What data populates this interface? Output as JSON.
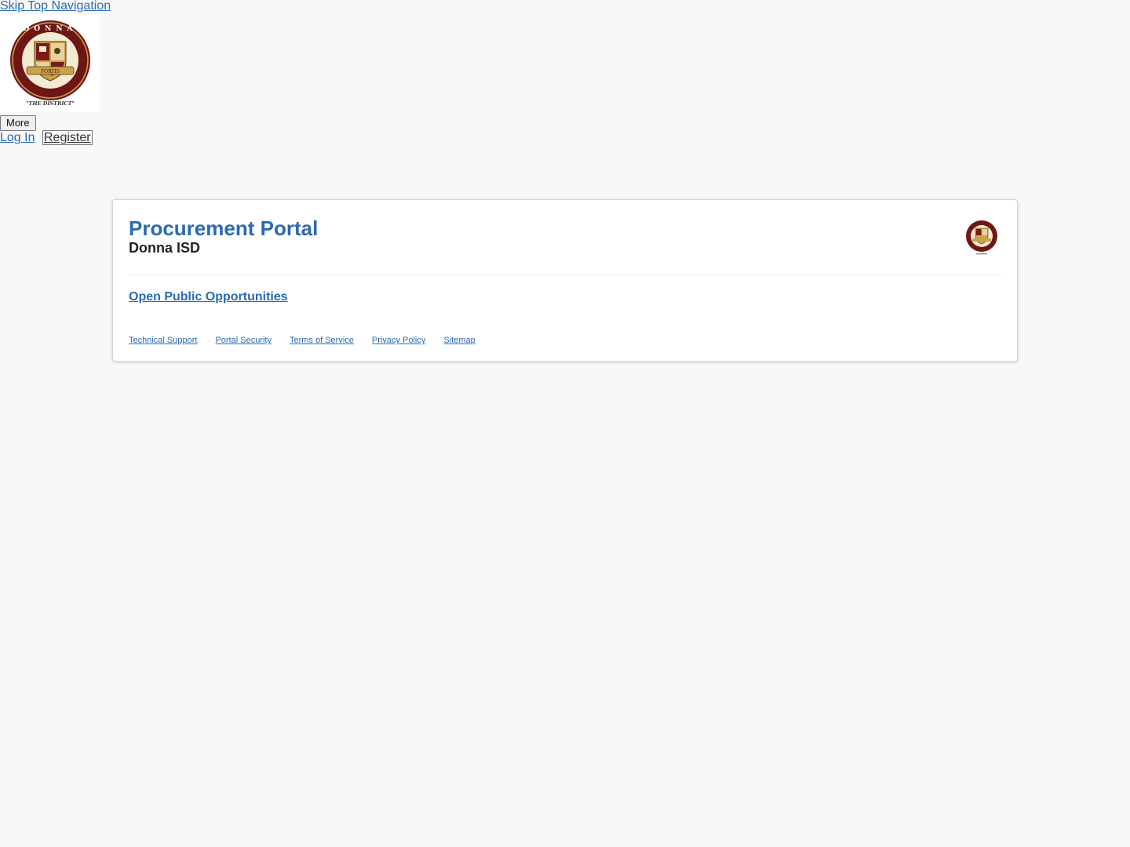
{
  "skip_nav": {
    "label": "Skip Top Navigation"
  },
  "header": {
    "logo_icon": "donna-isd-crest-icon",
    "logo_text": {
      "top": "DONNA",
      "motto": "FORTIS",
      "tagline": "\"THE DISTRICT\""
    },
    "more_label": "More",
    "login_label": "Log In",
    "register_label": "Register"
  },
  "card": {
    "title": "Procurement Portal",
    "org_name": "Donna ISD",
    "logo_icon": "donna-isd-crest-icon",
    "open_opportunities_label": "Open Public Opportunities"
  },
  "footer": {
    "links": [
      {
        "label": "Technical Support"
      },
      {
        "label": "Portal Security"
      },
      {
        "label": "Terms of Service"
      },
      {
        "label": "Privacy Policy"
      },
      {
        "label": "Sitemap"
      }
    ]
  },
  "colors": {
    "link": "#2a6ab0",
    "background": "#f8f8f8",
    "crest_maroon": "#7a1a1a",
    "crest_gold": "#c9a24a"
  }
}
